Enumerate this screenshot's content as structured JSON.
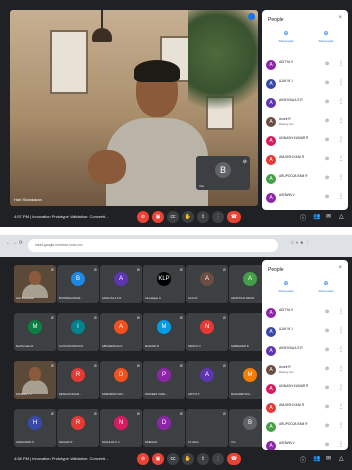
{
  "top": {
    "main_participant_label": "Hari Shankaran",
    "self_tile": {
      "initial": "B",
      "label": "You"
    },
    "people_panel": {
      "title": "People",
      "actions": [
        {
          "label": "Add people",
          "icon": "add-person-icon"
        },
        {
          "label": "Add people",
          "icon": "add-person-icon"
        }
      ],
      "rows": [
        {
          "initial": "A",
          "name": "ADITYA V",
          "sub": "",
          "color": "#8e24aa"
        },
        {
          "initial": "A",
          "name": "AJAY M J",
          "sub": "",
          "color": "#3949ab"
        },
        {
          "initial": "A",
          "name": "AKSHYAA A S R",
          "sub": "",
          "color": "#5e35b1"
        },
        {
          "initial": "A",
          "name": "Anurit R",
          "sub": "Raising hun",
          "color": "#6d4c41"
        },
        {
          "initial": "A",
          "name": "AVINASH KUMAR R",
          "sub": "",
          "color": "#d81b60"
        },
        {
          "initial": "A",
          "name": "ANUJISH KANI R",
          "sub": "",
          "color": "#e53935"
        },
        {
          "initial": "A",
          "name": "ARUPOOJA RAM R",
          "sub": "",
          "color": "#43a047"
        },
        {
          "initial": "A",
          "name": "ASHWIN V",
          "sub": "",
          "color": "#8e24aa"
        }
      ]
    },
    "bottom_bar": {
      "time_meeting": "4:57 PM | Innovation Prototype Validation: Conventi..."
    }
  },
  "bottom": {
    "browser": {
      "url": "meet.google.com/xxx-xxxx-xxx"
    },
    "grid": [
      {
        "initial": "",
        "name": "Hari Shankaran",
        "color": "#5b4a39",
        "video": true
      },
      {
        "initial": "B",
        "name": "BOOMISHANKAR...",
        "color": "#1e88e5"
      },
      {
        "initial": "A",
        "name": "AKSHYAA A S R",
        "color": "#5e35b1"
      },
      {
        "initial": "KLP",
        "name": "Kamalappa G",
        "color": "#000000"
      },
      {
        "initial": "A",
        "name": "Anurit R",
        "color": "#6d4c41"
      },
      {
        "initial": "A",
        "name": "ARUPOOJA RAM R",
        "color": "#43a047"
      },
      {
        "initial": "M",
        "name": "Murthumalar R",
        "color": "#0b8043"
      },
      {
        "initial": "I",
        "name": "ILAIYA BOOPATHI R",
        "color": "#00838f"
      },
      {
        "initial": "A",
        "name": "ABISHEKRAJA R",
        "color": "#f4511e"
      },
      {
        "initial": "M",
        "name": "MADHAN R",
        "color": "#039be5"
      },
      {
        "initial": "N",
        "name": "NIRAV R V",
        "color": "#e53935"
      },
      {
        "initial": "",
        "name": "SHREEHARI B",
        "color": "#000000"
      },
      {
        "initial": "",
        "name": "RAMESH V J",
        "color": "#5b4a39",
        "video": true
      },
      {
        "initial": "R",
        "name": "RESHAN NIGAM...",
        "color": "#e53935"
      },
      {
        "initial": "D",
        "name": "DINESWARI SOK...",
        "color": "#f4511e"
      },
      {
        "initial": "P",
        "name": "PRAVEEN CHAN...",
        "color": "#8e24aa"
      },
      {
        "initial": "A",
        "name": "ADITYA V",
        "color": "#5e35b1"
      },
      {
        "initial": "M",
        "name": "MOHAMED RIA...",
        "color": "#f57c00"
      },
      {
        "initial": "H",
        "name": "HARIHARAN S",
        "color": "#3949ab"
      },
      {
        "initial": "R",
        "name": "RAGHAV R",
        "color": "#e53935"
      },
      {
        "initial": "N",
        "name": "NAGULAN U C",
        "color": "#d81b60"
      },
      {
        "initial": "D",
        "name": "DINESH R",
        "color": "#8e24aa"
      },
      {
        "initial": "",
        "name": "37 others",
        "color": "#3c4043"
      },
      {
        "initial": "B",
        "name": "You",
        "color": "#5f6368"
      }
    ],
    "people_panel": {
      "title": "People",
      "rows": [
        {
          "initial": "A",
          "name": "ADITYA V",
          "sub": "",
          "color": "#8e24aa"
        },
        {
          "initial": "A",
          "name": "AJAY M J",
          "sub": "",
          "color": "#3949ab"
        },
        {
          "initial": "A",
          "name": "AKSHYAA A S R",
          "sub": "",
          "color": "#5e35b1"
        },
        {
          "initial": "A",
          "name": "Anurit R",
          "sub": "Raising hun",
          "color": "#6d4c41"
        },
        {
          "initial": "A",
          "name": "AVINASH KUMAR R",
          "sub": "",
          "color": "#d81b60"
        },
        {
          "initial": "A",
          "name": "ANUJISH KANI R",
          "sub": "",
          "color": "#e53935"
        },
        {
          "initial": "A",
          "name": "ARUPOOJA RAM R",
          "sub": "",
          "color": "#43a047"
        },
        {
          "initial": "A",
          "name": "ASHWIN V",
          "sub": "",
          "color": "#8e24aa"
        }
      ]
    },
    "bottom_bar": {
      "time_meeting": "4:58 PM | Innovation Prototype Validation: Conventi..."
    }
  }
}
